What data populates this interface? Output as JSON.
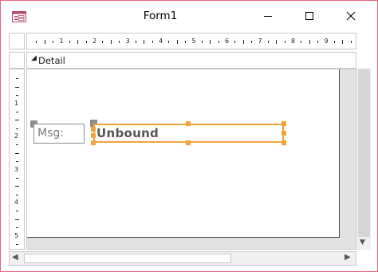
{
  "window": {
    "title": "Form1"
  },
  "section": {
    "label": "Detail"
  },
  "controls": {
    "label_text": "Msg:",
    "textbox_text": "Unbound"
  },
  "ruler_top_numbers": [
    "1",
    "2",
    "3",
    "4",
    "5",
    "6",
    "7",
    "8",
    "9"
  ],
  "ruler_left_numbers": [
    "1",
    "2",
    "3",
    "4",
    "5"
  ],
  "icons": {
    "app": "form-icon",
    "minimize": "minimize-icon",
    "maximize": "maximize-icon",
    "close": "close-icon"
  },
  "colors": {
    "window_border": "#e0637a",
    "selection": "#f0a33a"
  }
}
